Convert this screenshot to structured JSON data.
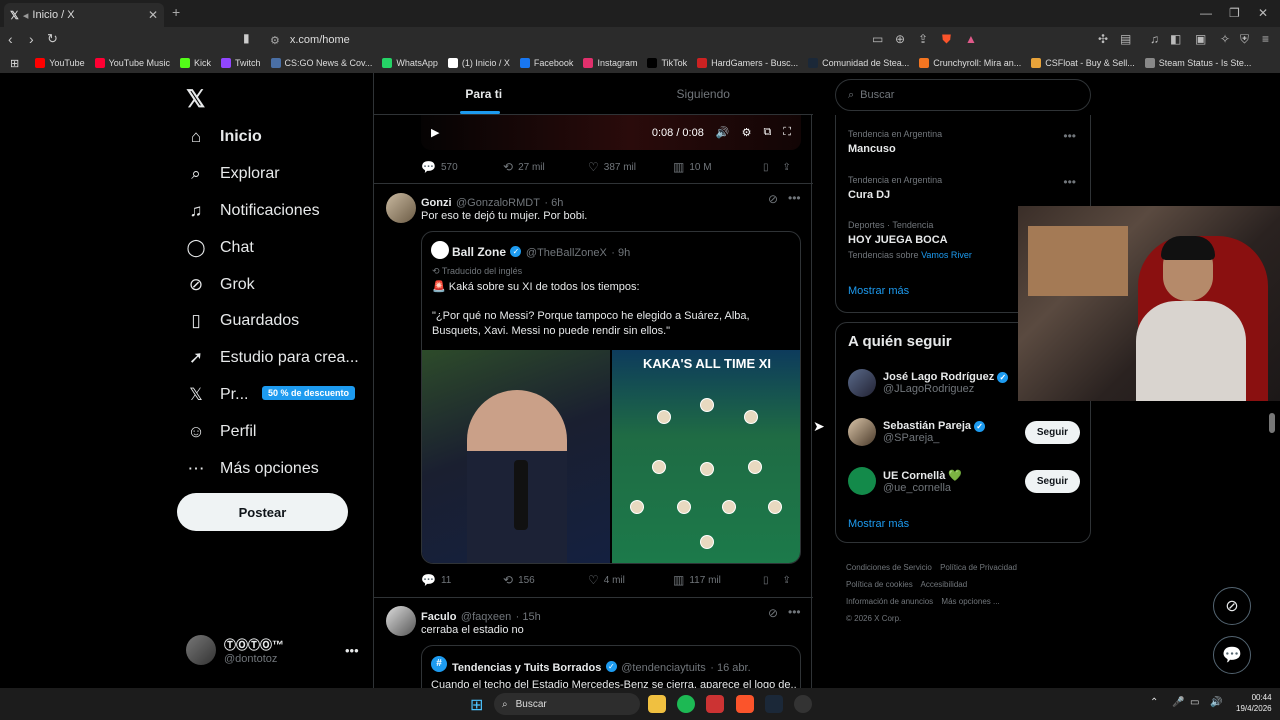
{
  "browser": {
    "tab_title": "Inicio / X",
    "tab_icon": "x-logo-icon",
    "url": "x.com/home",
    "bookmarks": [
      {
        "label": "YouTube",
        "color": "#ff0000"
      },
      {
        "label": "YouTube Music",
        "color": "#ff0033"
      },
      {
        "label": "Kick",
        "color": "#53fc18"
      },
      {
        "label": "Twitch",
        "color": "#9146ff"
      },
      {
        "label": "CS:GO News & Cov...",
        "color": "#4a6fa5"
      },
      {
        "label": "WhatsApp",
        "color": "#25d366"
      },
      {
        "label": "(1) Inicio / X",
        "color": "#ffffff"
      },
      {
        "label": "Facebook",
        "color": "#1877f2"
      },
      {
        "label": "Instagram",
        "color": "#e1306c"
      },
      {
        "label": "TikTok",
        "color": "#000000"
      },
      {
        "label": "HardGamers - Busc...",
        "color": "#cc2222"
      },
      {
        "label": "Comunidad de Stea...",
        "color": "#1b2838"
      },
      {
        "label": "Crunchyroll: Mira an...",
        "color": "#f47521"
      },
      {
        "label": "CSFloat - Buy & Sell...",
        "color": "#e8a33a"
      },
      {
        "label": "Steam Status - Is Ste...",
        "color": "#888888"
      }
    ]
  },
  "nav": {
    "items": [
      {
        "label": "Inicio",
        "icon": "home-icon"
      },
      {
        "label": "Explorar",
        "icon": "search-icon"
      },
      {
        "label": "Notificaciones",
        "icon": "bell-icon"
      },
      {
        "label": "Chat",
        "icon": "chat-icon"
      },
      {
        "label": "Grok",
        "icon": "grok-icon"
      },
      {
        "label": "Guardados",
        "icon": "bookmark-icon"
      },
      {
        "label": "Estudio para crea...",
        "icon": "rocket-icon"
      },
      {
        "label": "Pr...",
        "icon": "x-premium-icon"
      },
      {
        "label": "Perfil",
        "icon": "person-icon"
      },
      {
        "label": "Más opciones",
        "icon": "more-circle-icon"
      }
    ],
    "promo_badge": "50 % de descuento",
    "post_button": "Postear",
    "account": {
      "name": "ⓉⓄⓉⓄ™",
      "handle": "@dontotoz"
    }
  },
  "feed": {
    "tabs": [
      "Para ti",
      "Siguiendo"
    ],
    "video": {
      "time": "0:08 / 0:08"
    },
    "top_actions": {
      "replies": "570",
      "reposts": "27 mil",
      "likes": "387 mil",
      "views": "10 M"
    },
    "tweet1": {
      "name": "Gonzi",
      "handle": "@GonzaloRMDT",
      "time": "· 6h",
      "text": "Por eso te dejó tu mujer. Por bobi.",
      "quote": {
        "name": "Ball Zone",
        "handle": "@TheBallZoneX",
        "time": "· 9h",
        "translated": "Traducido del inglés",
        "line1": "🚨 Kaká sobre su XI de todos los tiempos:",
        "line2": "\"¿Por qué no Messi? Porque tampoco he elegido a Suárez, Alba, Busquets, Xavi. Messi no puede rendir sin ellos.\"",
        "image_title": "KAKA'S ALL TIME XI"
      },
      "actions": {
        "replies": "11",
        "reposts": "156",
        "likes": "4 mil",
        "views": "117 mil"
      }
    },
    "tweet2": {
      "name": "Faculo",
      "handle": "@faqxeen",
      "time": "· 15h",
      "text": "cerraba el estadio no",
      "quote": {
        "name": "Tendencias y Tuits Borrados",
        "handle": "@tendenciaytuits",
        "time": "· 16 abr.",
        "text": "Cuando el techo del Estadio Mercedes-Benz se cierra, aparece el logo de..."
      }
    }
  },
  "sidebar": {
    "search_placeholder": "Buscar",
    "trends": [
      {
        "category": "Tendencia en Argentina",
        "title": "Mancuso",
        "sub": "",
        "sub_link": ""
      },
      {
        "category": "Tendencia en Argentina",
        "title": "Cura DJ",
        "sub": "",
        "sub_link": ""
      },
      {
        "category": "Deportes · Tendencia",
        "title": "HOY JUEGA BOCA",
        "sub": "Tendencias sobre",
        "sub_link": "Vamos River"
      }
    ],
    "show_more": "Mostrar más",
    "who_to_follow": {
      "title": "A quién seguir",
      "people": [
        {
          "name": "José Lago Rodríguez",
          "handle": "@JLagoRodriguez",
          "button": ""
        },
        {
          "name": "Sebastián Pareja",
          "handle": "@SPareja_",
          "button": "Seguir"
        },
        {
          "name": "UE Cornellà 💚",
          "handle": "@ue_cornella",
          "button": "Seguir"
        }
      ],
      "show_more": "Mostrar más"
    },
    "footer": {
      "links": [
        "Condiciones de Servicio",
        "Política de Privacidad",
        "Política de cookies",
        "Accesibilidad",
        "Información de anuncios",
        "Más opciones ..."
      ],
      "copyright": "© 2026 X Corp."
    }
  },
  "taskbar": {
    "search": "Buscar",
    "time": "00:44",
    "date": "19/4/2026"
  }
}
